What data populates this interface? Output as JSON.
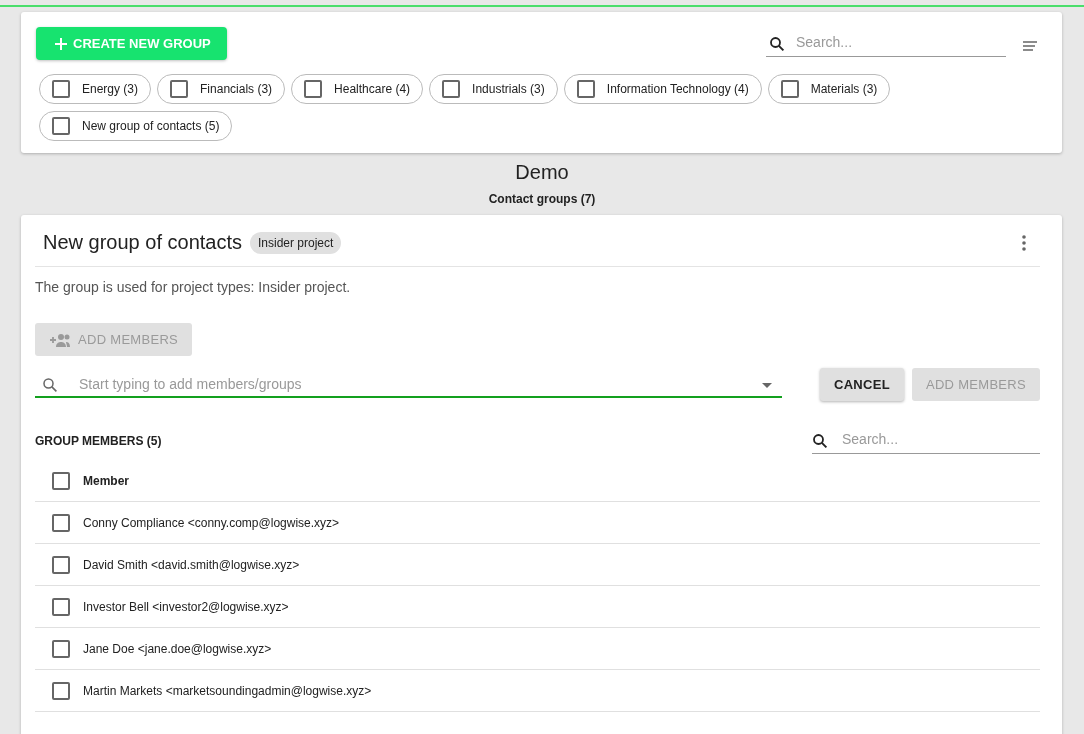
{
  "toolbar": {
    "create_button": {
      "label": "CREATE NEW GROUP"
    },
    "search": {
      "placeholder": "Search..."
    }
  },
  "group_chips": [
    {
      "label": "Energy (3)",
      "checked": false
    },
    {
      "label": "Financials (3)",
      "checked": false
    },
    {
      "label": "Healthcare (4)",
      "checked": false
    },
    {
      "label": "Industrials (3)",
      "checked": false
    },
    {
      "label": "Information Technology (4)",
      "checked": false
    },
    {
      "label": "Materials (3)",
      "checked": false
    },
    {
      "label": "New group of contacts (5)",
      "checked": false
    }
  ],
  "page": {
    "title": "Demo",
    "subtitle": "Contact groups (7)"
  },
  "group": {
    "title": "New group of contacts",
    "tag": "Insider project",
    "description": "The group is used for project types: Insider project.",
    "add_members_button": {
      "label": "ADD MEMBERS",
      "disabled": true
    },
    "member_search": {
      "placeholder": "Start typing to add members/groups"
    },
    "cancel_button": {
      "label": "CANCEL",
      "disabled": false
    },
    "confirm_button": {
      "label": "ADD MEMBERS",
      "disabled": true
    },
    "members_heading": "GROUP MEMBERS (5)",
    "members_search": {
      "placeholder": "Search..."
    },
    "table": {
      "column": "Member",
      "all_checked": false,
      "rows": [
        {
          "member": "Conny Compliance <conny.comp@logwise.xyz>",
          "checked": false
        },
        {
          "member": "David Smith <david.smith@logwise.xyz>",
          "checked": false
        },
        {
          "member": "Investor Bell <investor2@logwise.xyz>",
          "checked": false
        },
        {
          "member": "Jane Doe <jane.doe@logwise.xyz>",
          "checked": false
        },
        {
          "member": "Martin Markets <marketsoundingadmin@logwise.xyz>",
          "checked": false
        }
      ]
    }
  }
}
